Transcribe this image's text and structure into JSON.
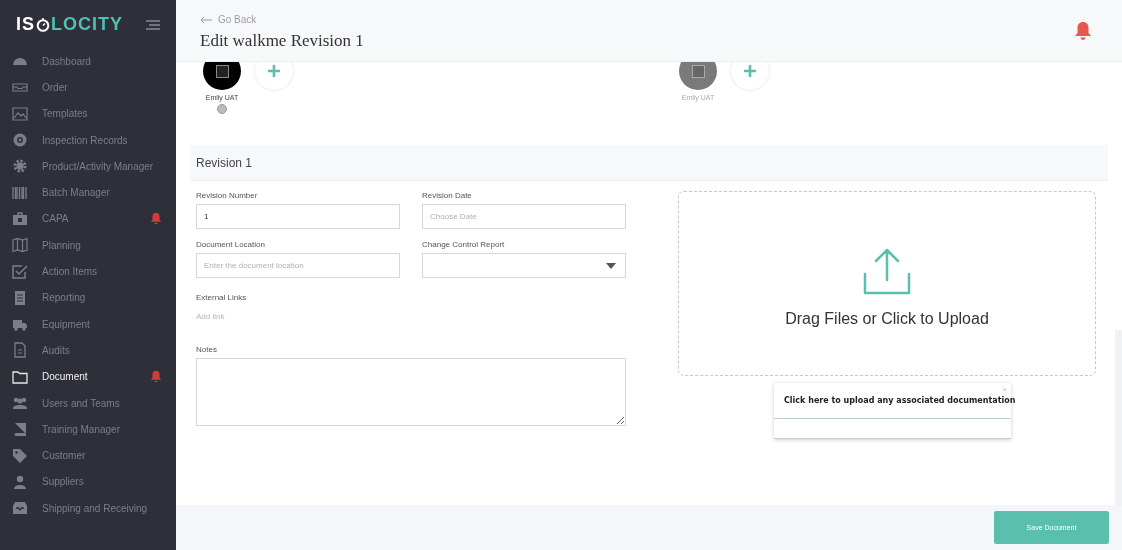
{
  "sidebar": {
    "logo": {
      "left": "IS",
      "right": "LOCITY"
    },
    "items": [
      {
        "label": "Dashboard",
        "selected": false,
        "alert": false
      },
      {
        "label": "Order",
        "selected": false,
        "alert": false
      },
      {
        "label": "Templates",
        "selected": false,
        "alert": false
      },
      {
        "label": "Inspection Records",
        "selected": false,
        "alert": false
      },
      {
        "label": "Product/Activity Manager",
        "selected": false,
        "alert": false
      },
      {
        "label": "Batch Manager",
        "selected": false,
        "alert": false
      },
      {
        "label": "CAPA",
        "selected": false,
        "alert": true
      },
      {
        "label": "Planning",
        "selected": false,
        "alert": false
      },
      {
        "label": "Action Items",
        "selected": false,
        "alert": false
      },
      {
        "label": "Reporting",
        "selected": false,
        "alert": false
      },
      {
        "label": "Equipment",
        "selected": false,
        "alert": false
      },
      {
        "label": "Audits",
        "selected": false,
        "alert": false
      },
      {
        "label": "Document",
        "selected": true,
        "alert": true
      },
      {
        "label": "Users and Teams",
        "selected": false,
        "alert": false
      },
      {
        "label": "Training Manager",
        "selected": false,
        "alert": false
      },
      {
        "label": "Customer",
        "selected": false,
        "alert": false
      },
      {
        "label": "Suppliers",
        "selected": false,
        "alert": false
      },
      {
        "label": "Shipping and Receiving",
        "selected": false,
        "alert": false
      }
    ]
  },
  "header": {
    "back": "Go Back",
    "title": "Edit walkme Revision 1"
  },
  "approvers": [
    {
      "name": "Emily UAT",
      "active": true
    },
    {
      "name": "Emily UAT",
      "active": false
    }
  ],
  "revision": {
    "title": "Revision 1",
    "fields": [
      {
        "kind": "text",
        "label": "Revision Number",
        "value": "1"
      },
      {
        "kind": "text",
        "label": "Revision Date",
        "placeholder": "Choose Date"
      },
      {
        "kind": "text",
        "label": "Document Location",
        "placeholder": "Enter the document location"
      },
      {
        "kind": "select",
        "label": "Change Control Report"
      }
    ],
    "links": {
      "label": "External Links",
      "action": "Add link"
    },
    "notes": {
      "label": "Notes"
    }
  },
  "upload": {
    "text": "Drag Files or Click to Upload"
  },
  "tooltip": {
    "text": "Click here to upload any associated documentation",
    "close": "×"
  },
  "footer": {
    "button": "Save Document"
  }
}
